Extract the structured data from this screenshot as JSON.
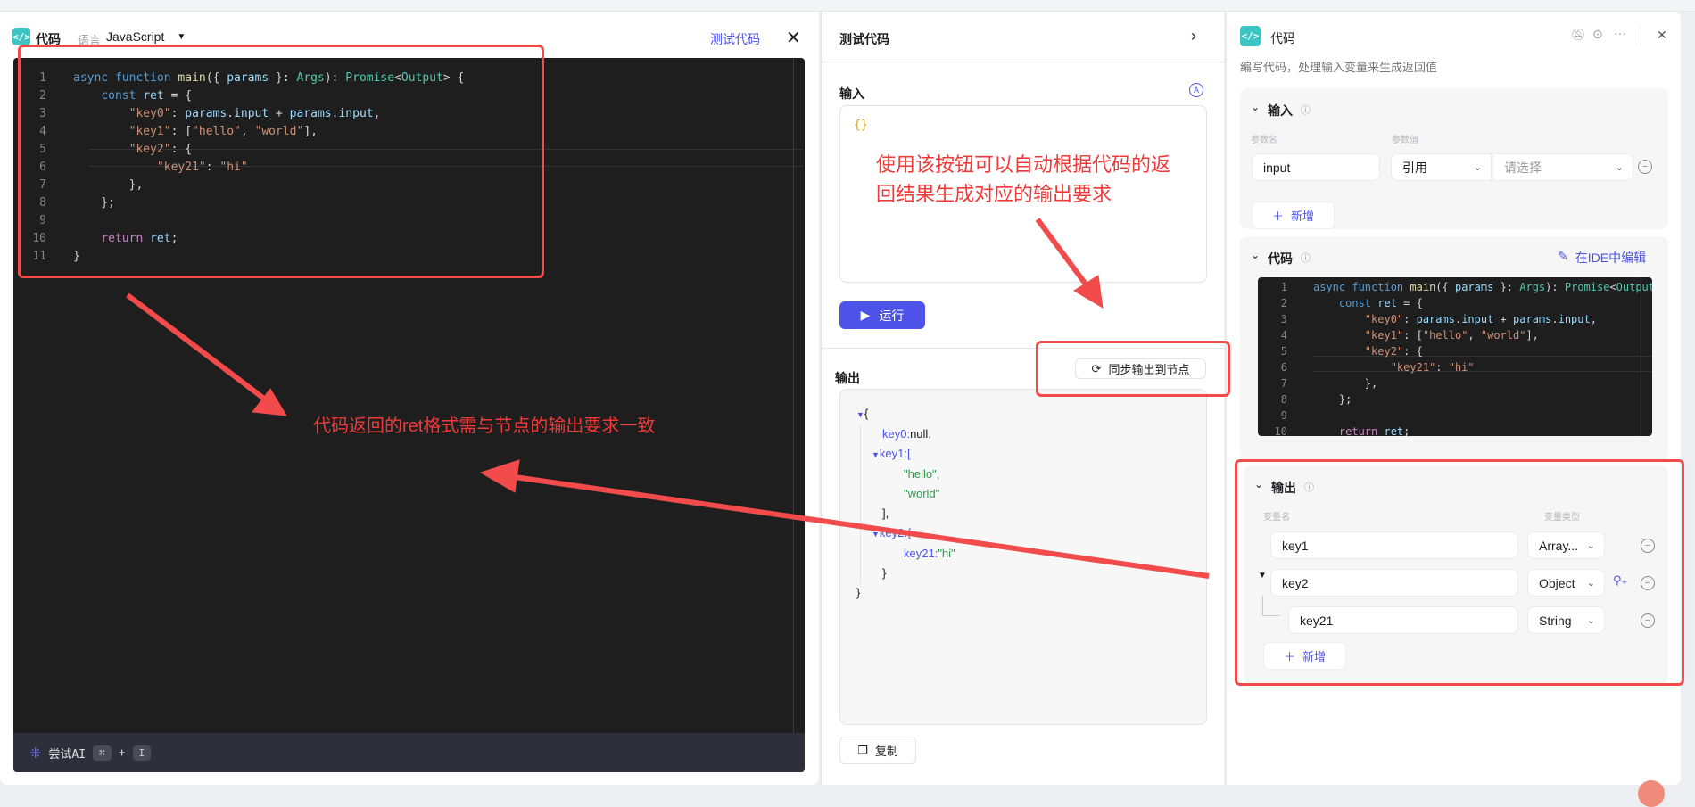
{
  "left": {
    "title": "代码",
    "language_label": "语言",
    "language_value": "JavaScript",
    "test_code_link": "测试代码",
    "ai_bar": {
      "label": "尝试AI",
      "key1": "⌘",
      "plus": "+",
      "key2": "I"
    }
  },
  "code": [
    [
      [
        "kw",
        "async "
      ],
      [
        "kw",
        "function "
      ],
      [
        "fn",
        "main"
      ],
      [
        "pun",
        "({ "
      ],
      [
        "var",
        "params"
      ],
      [
        "pun",
        " }: "
      ],
      [
        "type",
        "Args"
      ],
      [
        "pun",
        "): "
      ],
      [
        "type",
        "Promise"
      ],
      [
        "pun",
        "<"
      ],
      [
        "type",
        "Output"
      ],
      [
        "pun",
        "> {"
      ]
    ],
    [
      [
        "pun",
        "    "
      ],
      [
        "kw",
        "const "
      ],
      [
        "var",
        "ret"
      ],
      [
        "pun",
        " = {"
      ]
    ],
    [
      [
        "pun",
        "        "
      ],
      [
        "str",
        "\"key0\""
      ],
      [
        "pun",
        ": "
      ],
      [
        "var",
        "params"
      ],
      [
        "pun",
        "."
      ],
      [
        "var",
        "input"
      ],
      [
        "pun",
        " + "
      ],
      [
        "var",
        "params"
      ],
      [
        "pun",
        "."
      ],
      [
        "var",
        "input"
      ],
      [
        "pun",
        ","
      ]
    ],
    [
      [
        "pun",
        "        "
      ],
      [
        "str",
        "\"key1\""
      ],
      [
        "pun",
        ": ["
      ],
      [
        "str",
        "\"hello\""
      ],
      [
        "pun",
        ", "
      ],
      [
        "str",
        "\"world\""
      ],
      [
        "pun",
        "],"
      ]
    ],
    [
      [
        "pun",
        "        "
      ],
      [
        "str",
        "\"key2\""
      ],
      [
        "pun",
        ": {"
      ]
    ],
    [
      [
        "pun",
        "            "
      ],
      [
        "str",
        "\"key21\""
      ],
      [
        "pun",
        ": "
      ],
      [
        "str",
        "\"hi\""
      ]
    ],
    [
      [
        "pun",
        "        },"
      ]
    ],
    [
      [
        "pun",
        "    };"
      ]
    ],
    [],
    [
      [
        "pun",
        "    "
      ],
      [
        "ret",
        "return "
      ],
      [
        "var",
        "ret"
      ],
      [
        "pun",
        ";"
      ]
    ],
    [
      [
        "pun",
        "}"
      ]
    ]
  ],
  "test": {
    "title": "测试代码",
    "input_label": "输入",
    "input_value": "{}",
    "run_button": "运行",
    "output_label": "输出",
    "sync_button": "同步输出到节点",
    "copy_button": "复制",
    "output_json": {
      "open": "{",
      "key0_key": "key0:",
      "key0_val": "null,",
      "key1_key": "key1:[",
      "hello": "\"hello\",",
      "world": "\"world\"",
      "key1_close": "],",
      "key2_key": "key2:{",
      "key21_key": "key21:",
      "key21_val": "\"hi\"",
      "key2_close": "}",
      "close": "}"
    }
  },
  "node": {
    "title": "代码",
    "description": "编写代码，处理输入变量来生成返回值",
    "input_section": {
      "title": "输入",
      "col_name": "参数名",
      "col_value": "参数值",
      "param_name": "input",
      "param_type": "引用",
      "param_value_placeholder": "请选择",
      "add_button": "新增"
    },
    "code_section": {
      "title": "代码",
      "edit_in_ide": "在IDE中编辑"
    },
    "output_section": {
      "title": "输出",
      "col_name": "变量名",
      "col_type": "变量类型",
      "rows": [
        {
          "name": "key1",
          "type": "Array..."
        },
        {
          "name": "key2",
          "type": "Object"
        },
        {
          "name": "key21",
          "type": "String"
        }
      ],
      "add_button": "新增"
    }
  },
  "annotations": {
    "sync_hint_line1": "使用该按钮可以自动根据代码的返",
    "sync_hint_line2": "回结果生成对应的输出要求",
    "format_hint": "代码返回的ret格式需与节点的输出要求一致"
  },
  "colors": {
    "accent": "#4d53e8",
    "annotation": "#f24b4b",
    "logo": "#3cc5c4",
    "editor_bg": "#1e1e1e"
  }
}
